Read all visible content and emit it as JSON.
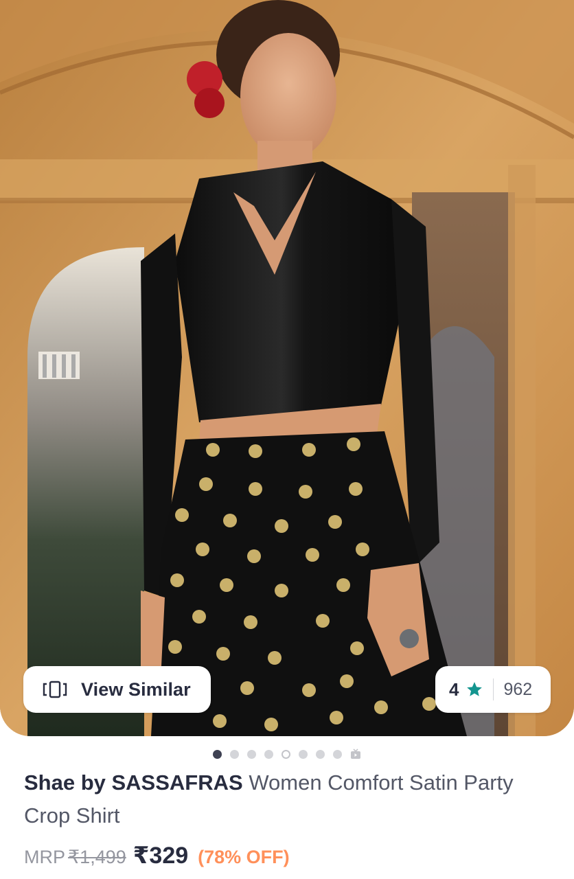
{
  "product_image": {
    "description_icon": "product-photo"
  },
  "view_similar": {
    "icon": "view-similar-icon",
    "label": "View Similar"
  },
  "rating": {
    "value": "4",
    "star_icon": "star-icon",
    "star_color": "#14958f",
    "count": "962"
  },
  "carousel": {
    "total_dots": 9,
    "active_index": 0,
    "hollow_index": 4,
    "last_is_video": true
  },
  "product": {
    "brand": "Shae by SASSAFRAS",
    "name": " Women Comfort Satin Party Crop Shirt"
  },
  "price": {
    "mrp_label": "MRP",
    "mrp_value": "₹1,499",
    "sale_price": "₹329",
    "discount": "(78% OFF)",
    "discount_color": "#ff905a"
  }
}
